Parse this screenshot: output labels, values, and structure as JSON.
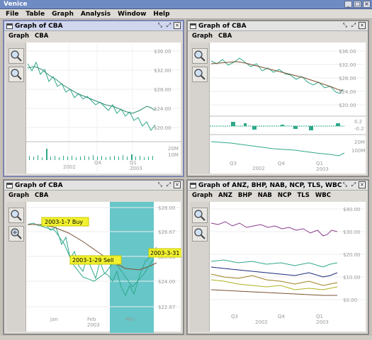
{
  "app": {
    "title": "Venice"
  },
  "menubar": [
    "File",
    "Table",
    "Graph",
    "Analysis",
    "Window",
    "Help"
  ],
  "windows": [
    {
      "title": "Graph of CBA",
      "menu": [
        "Graph",
        "CBA"
      ],
      "y_labels": [
        "$36.00",
        "$32.00",
        "$28.00",
        "$24.00",
        "$20.00"
      ],
      "volume_labels": [
        "20M",
        "10M"
      ],
      "x_labels": [
        "2002",
        "Q4",
        "Q1",
        "2003"
      ]
    },
    {
      "title": "Graph of CBA",
      "menu": [
        "Graph",
        "CBA"
      ],
      "y_labels": [
        "$36.00",
        "$32.00",
        "$28.00",
        "$24.00",
        "$20.00"
      ],
      "indicator_labels": [
        "0.2",
        "-0.2"
      ],
      "volume_labels": [
        "20M",
        "100M"
      ],
      "x_labels": [
        "Q3",
        "2002",
        "Q4",
        "Q1",
        "2003"
      ]
    },
    {
      "title": "Graph of CBA",
      "menu": [
        "Graph",
        "CBA"
      ],
      "y_labels": [
        "$28.00",
        "$26.67",
        "$25.33",
        "$24.00",
        "$22.67"
      ],
      "x_labels": [
        "Jan",
        "Feb",
        "2003",
        "Mar"
      ],
      "annotations": [
        "2003-1-7  Buy",
        "2003-1-29  Sell",
        "2003-3-31"
      ]
    },
    {
      "title": "Graph of ANZ, BHP, NAB, NCP, TLS, WBC",
      "menu": [
        "Graph",
        "ANZ",
        "BHP",
        "NAB",
        "NCP",
        "TLS",
        "WBC"
      ],
      "y_labels": [
        "$40.00",
        "$30.00",
        "$20.00",
        "$10.00",
        "$0.00"
      ],
      "x_labels": [
        "Q3",
        "2002",
        "Q4",
        "Q1",
        "2003"
      ]
    }
  ],
  "colors": {
    "chart_teal": "#2fa88a",
    "chart_brown": "#7a5030",
    "highlight": "#66c6c8",
    "annotation": "#f2f230"
  }
}
